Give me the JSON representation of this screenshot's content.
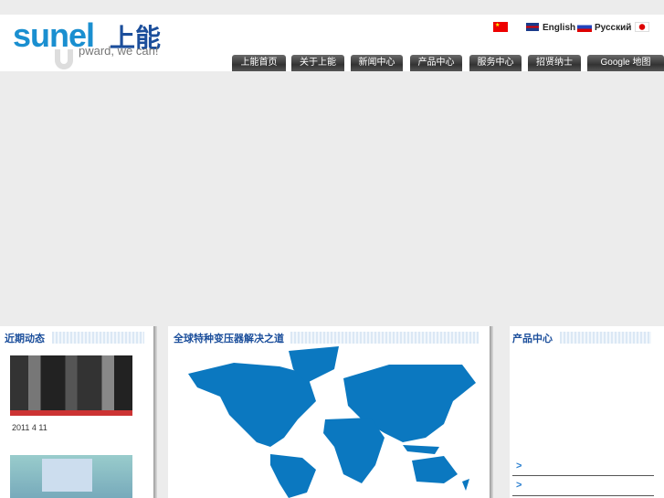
{
  "logo": {
    "brand": "sunel",
    "chinese": "上能",
    "slogan": "pward, we can!"
  },
  "languages": [
    {
      "label": "",
      "icon": "china-flag-icon"
    },
    {
      "label": "English",
      "icon": "uk-flag-icon"
    },
    {
      "label": "Русский",
      "icon": "russia-flag-icon"
    },
    {
      "label": "",
      "icon": "japan-flag-icon"
    }
  ],
  "nav": [
    "上能首页",
    "关于上能",
    "新闻中心",
    "产品中心",
    "服务中心",
    "招贤纳士",
    "Google 地图"
  ],
  "news": {
    "title": "近期动态",
    "items": [
      {
        "date": "2011 4 11"
      }
    ]
  },
  "map": {
    "title": "全球特种变压器解决之道"
  },
  "products": {
    "title": "产品中心",
    "items": [
      ">",
      ">"
    ]
  },
  "colors": {
    "brand_blue": "#1a8fd0",
    "map_blue": "#0b78c0",
    "title_blue": "#1b4e9b"
  }
}
